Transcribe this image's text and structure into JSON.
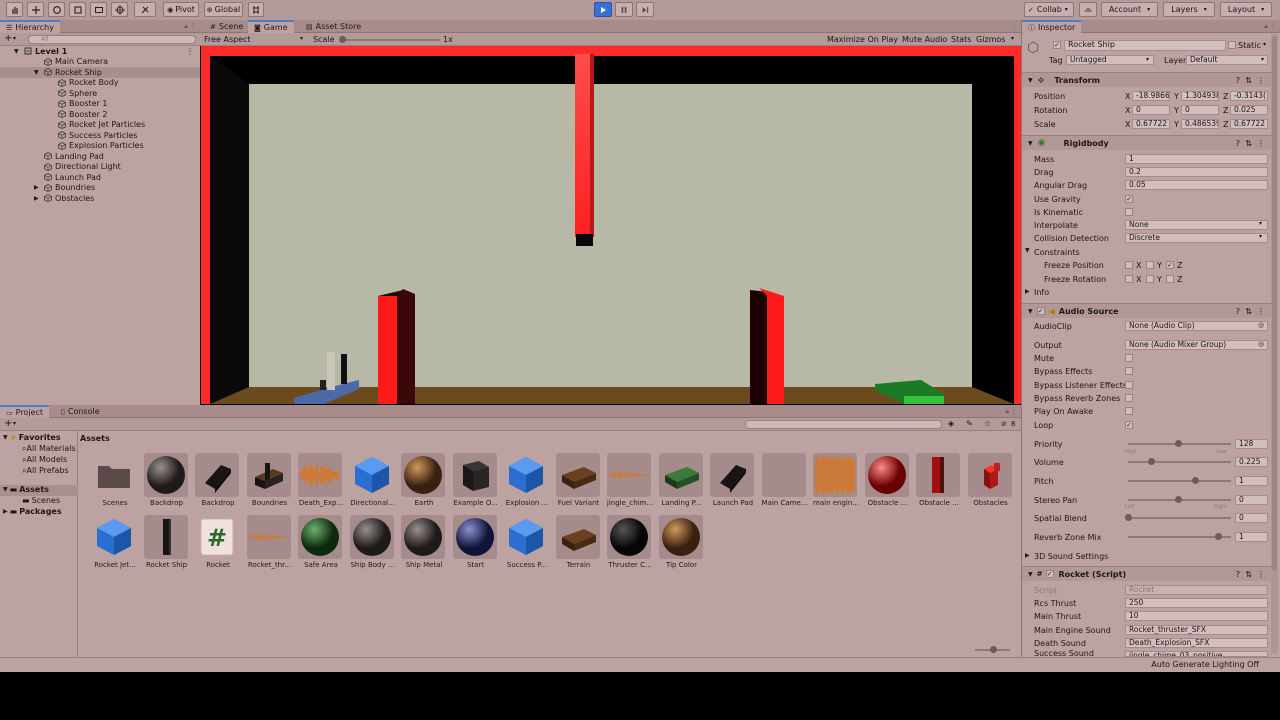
{
  "toolbar": {
    "pivot": "Pivot",
    "global": "Global",
    "collab": "Collab",
    "account": "Account",
    "layers": "Layers",
    "layout": "Layout",
    "play_color": "#3a6fd6"
  },
  "hierarchy": {
    "tab": "Hierarchy",
    "search_placeholder": "All",
    "items": [
      {
        "label": "Level 1"
      },
      {
        "label": "Main Camera"
      },
      {
        "label": "Rocket Ship"
      },
      {
        "label": "Rocket Body"
      },
      {
        "label": "Sphere"
      },
      {
        "label": "Booster 1"
      },
      {
        "label": "Booster 2"
      },
      {
        "label": "Rocket Jet Particles"
      },
      {
        "label": "Success Particles"
      },
      {
        "label": "Explosion Particles"
      },
      {
        "label": "Landing Pad"
      },
      {
        "label": "Directional Light"
      },
      {
        "label": "Launch Pad"
      },
      {
        "label": "Boundries"
      },
      {
        "label": "Obstacles"
      }
    ]
  },
  "center": {
    "tabs": [
      "Scene",
      "Game",
      "Asset Store"
    ],
    "aspect": "Free Aspect",
    "scale_label": "Scale",
    "scale_value": "1x",
    "maximize": "Maximize On Play",
    "mute": "Mute Audio",
    "stats": "Stats",
    "gizmos": "Gizmos"
  },
  "project": {
    "tabs": [
      "Project",
      "Console"
    ],
    "favorites": "Favorites",
    "fav_items": [
      "All Materials",
      "All Models",
      "All Prefabs"
    ],
    "assets_label": "Assets",
    "assets_sub": [
      "Scenes"
    ],
    "packages": "Packages",
    "breadcrumb": "Assets",
    "count": "8",
    "assets": [
      {
        "label": "Scenes",
        "kind": "folder"
      },
      {
        "label": "Backdrop",
        "kind": "sphere-dark"
      },
      {
        "label": "Backdrop",
        "kind": "slab-dark"
      },
      {
        "label": "Boundries",
        "kind": "boundries"
      },
      {
        "label": "Death_Exp...",
        "kind": "audio"
      },
      {
        "label": "Directional...",
        "kind": "prefab"
      },
      {
        "label": "Earth",
        "kind": "sphere-brown"
      },
      {
        "label": "Example O...",
        "kind": "cube-dark"
      },
      {
        "label": "Explosion ...",
        "kind": "prefab"
      },
      {
        "label": "Fuel Variant",
        "kind": "slab-brown"
      },
      {
        "label": "jingle_chim...",
        "kind": "audio-thin"
      },
      {
        "label": "Landing P...",
        "kind": "slab-green"
      },
      {
        "label": "Launch Pad",
        "kind": "slab-dark"
      },
      {
        "label": "Main Came...",
        "kind": "empty"
      },
      {
        "label": "main engin...",
        "kind": "audio-full"
      },
      {
        "label": "Obstacle ...",
        "kind": "sphere-red"
      },
      {
        "label": "Obstacle ...",
        "kind": "pillar-red"
      },
      {
        "label": "Obstacles",
        "kind": "obstacles"
      },
      {
        "label": "Rocket Jet...",
        "kind": "prefab"
      },
      {
        "label": "Rocket Ship",
        "kind": "rocket"
      },
      {
        "label": "Rocket",
        "kind": "script"
      },
      {
        "label": "Rocket_thr...",
        "kind": "audio-thin"
      },
      {
        "label": "Safe Area",
        "kind": "sphere-green"
      },
      {
        "label": "Ship Body ...",
        "kind": "sphere-dark"
      },
      {
        "label": "Ship Metal",
        "kind": "sphere-dark"
      },
      {
        "label": "Start",
        "kind": "sphere-blue"
      },
      {
        "label": "Success P...",
        "kind": "prefab"
      },
      {
        "label": "Terrain",
        "kind": "slab-brown"
      },
      {
        "label": "Thruster C...",
        "kind": "sphere-black"
      },
      {
        "label": "Tip Color",
        "kind": "sphere-brown"
      }
    ]
  },
  "inspector": {
    "tab": "Inspector",
    "object_name": "Rocket Ship",
    "static": "Static",
    "tag_label": "Tag",
    "tag_value": "Untagged",
    "layer_label": "Layer",
    "layer_value": "Default",
    "transform": {
      "title": "Transform",
      "position_label": "Position",
      "rotation_label": "Rotation",
      "scale_label": "Scale",
      "position": [
        "-18.9866",
        "1.304938",
        "-0.3143("
      ],
      "rotation": [
        "0",
        "0",
        "0.025"
      ],
      "scale": [
        "0.67722",
        "0.486539",
        "0.67722"
      ]
    },
    "rigidbody": {
      "title": "Rigidbody",
      "mass_label": "Mass",
      "mass": "1",
      "drag_label": "Drag",
      "drag": "0.2",
      "angular_label": "Angular Drag",
      "angular": "0.05",
      "gravity_label": "Use Gravity",
      "kinematic_label": "Is Kinematic",
      "interpolate_label": "Interpolate",
      "interpolate": "None",
      "collision_label": "Collision Detection",
      "collision": "Discrete",
      "constraints_label": "Constraints",
      "freeze_pos_label": "Freeze Position",
      "freeze_rot_label": "Freeze Rotation",
      "info_label": "Info"
    },
    "audio": {
      "title": "Audio Source",
      "clip_label": "AudioClip",
      "clip": "None (Audio Clip)",
      "output_label": "Output",
      "output": "None (Audio Mixer Group)",
      "mute_label": "Mute",
      "bypass_fx_label": "Bypass Effects",
      "bypass_listener_label": "Bypass Listener Effects",
      "bypass_reverb_label": "Bypass Reverb Zones",
      "play_awake_label": "Play On Awake",
      "loop_label": "Loop",
      "priority_label": "Priority",
      "priority": "128",
      "priority_frac": 0.5,
      "volume_label": "Volume",
      "volume": "0.225",
      "volume_frac": 0.225,
      "pitch_label": "Pitch",
      "pitch": "1",
      "pitch_frac": 0.67,
      "stereo_label": "Stereo Pan",
      "stereo": "0",
      "stereo_frac": 0.5,
      "spatial_label": "Spatial Blend",
      "spatial": "0",
      "spatial_frac": 0,
      "reverb_label": "Reverb Zone Mix",
      "reverb": "1",
      "reverb_frac": 0.9,
      "high": "High",
      "low": "Low",
      "left": "Left",
      "right": "Right",
      "sound3d_label": "3D Sound Settings"
    },
    "script": {
      "title": "Rocket (Script)",
      "script_label": "Script",
      "script": "Rocket",
      "rcs_label": "Rcs Thrust",
      "rcs": "250",
      "main_label": "Main Thrust",
      "main": "10",
      "engine_label": "Main Engine Sound",
      "engine": "Rocket_thruster_SFX",
      "death_label": "Death Sound",
      "death": "Death_Explosion_SFX",
      "success_label": "Success Sound",
      "success": "jingle_chime_03_positive"
    }
  },
  "statusbar": {
    "text": "Auto Generate Lighting Off"
  },
  "colors": {
    "editor_bg": "#bda2a2",
    "game_border": "#ff2a2a",
    "game_floor": "#6b4a1e",
    "game_wall": "#b7b9a6"
  }
}
